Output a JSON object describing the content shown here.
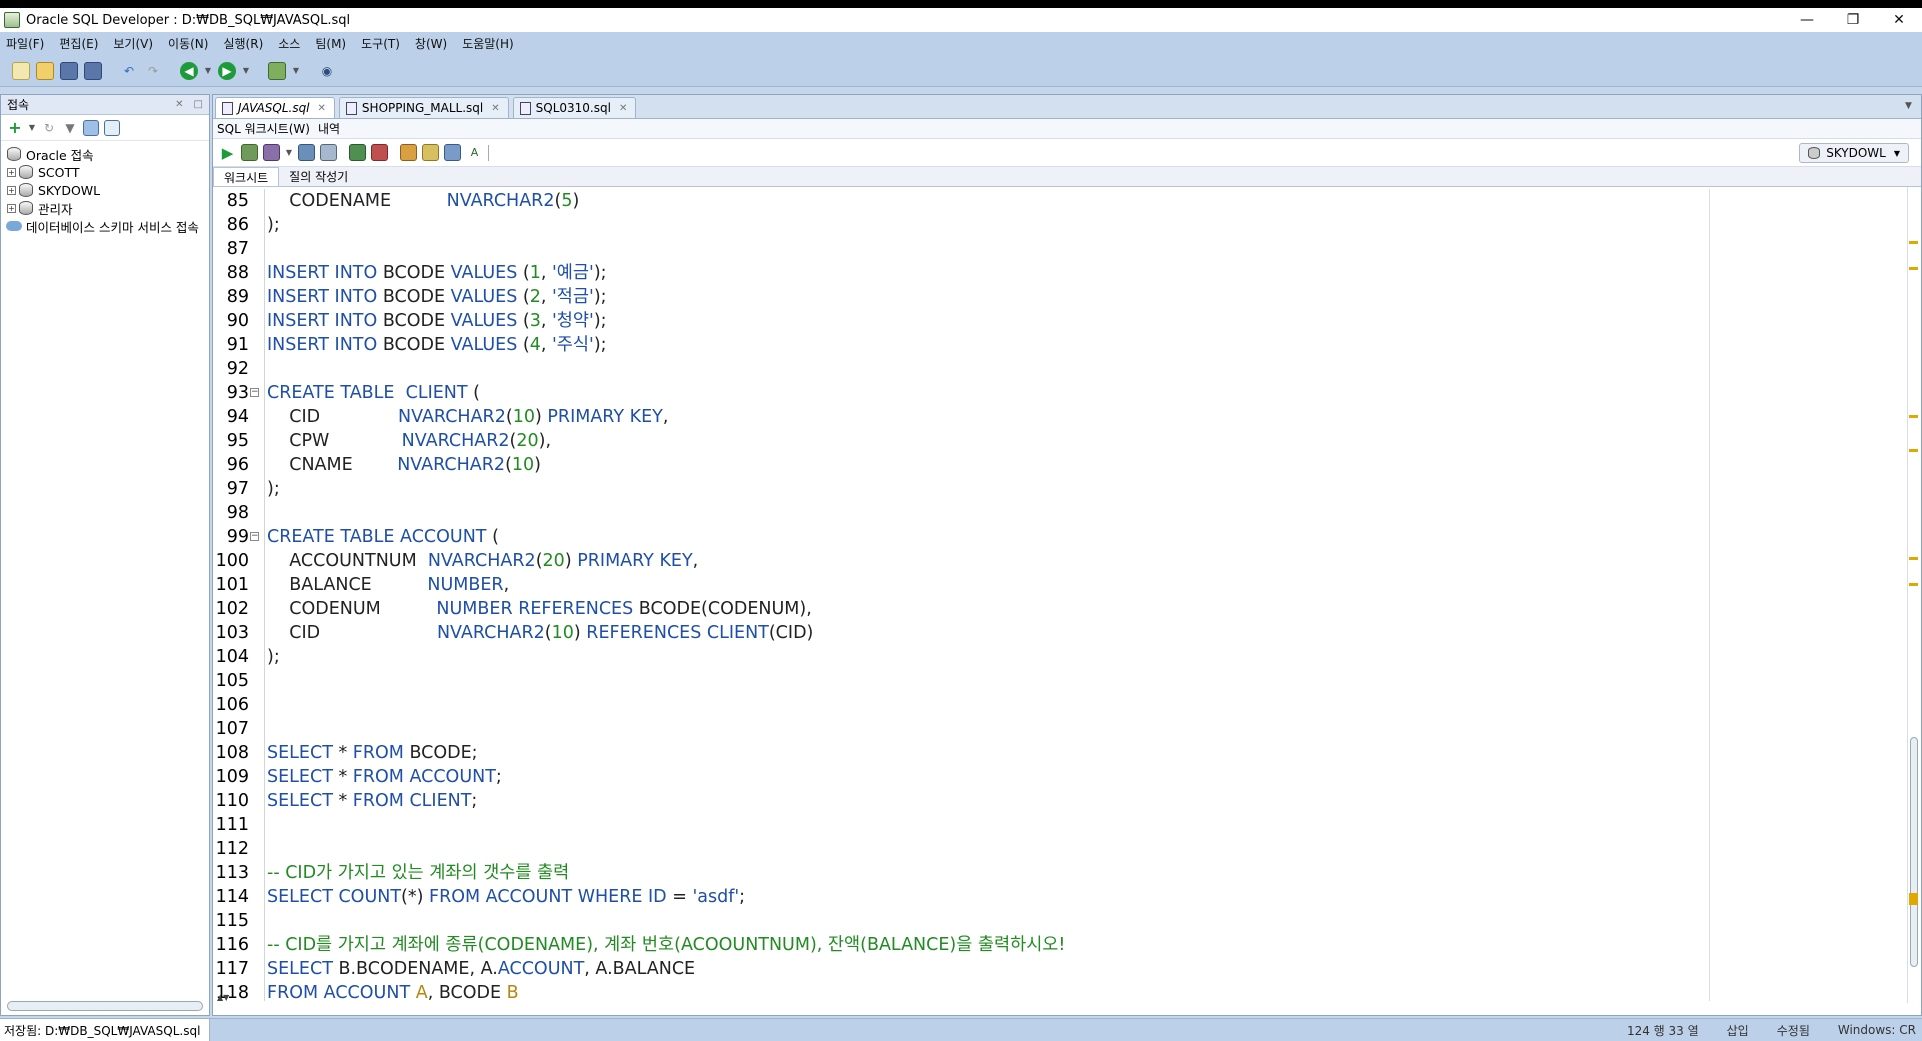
{
  "window": {
    "title": "Oracle SQL Developer : D:₩DB_SQL₩JAVASQL.sql"
  },
  "menu": [
    "파일(F)",
    "편집(E)",
    "보기(V)",
    "이동(N)",
    "실행(R)",
    "소스",
    "팀(M)",
    "도구(T)",
    "창(W)",
    "도움말(H)"
  ],
  "left_panel": {
    "title": "접속",
    "tree": [
      {
        "label": "Oracle 접속",
        "icon": "database-icon"
      },
      {
        "label": "SCOTT",
        "icon": "database-icon"
      },
      {
        "label": "SKYDOWL",
        "icon": "database-icon"
      },
      {
        "label": "관리자",
        "icon": "database-icon"
      },
      {
        "label": "데이터베이스 스키마 서비스 접속",
        "icon": "cloud-icon"
      }
    ]
  },
  "tabs": [
    "JAVASQL.sql",
    "SHOPPING_MALL.sql",
    "SQL0310.sql"
  ],
  "subtabs": {
    "worksheet": "SQL 워크시트(W)",
    "history": "내역"
  },
  "connection": "SKYDOWL",
  "ws_tabs": {
    "worksheet": "워크시트",
    "query_builder": "질의 작성기"
  },
  "code_lines": [
    {
      "n": "85",
      "t": [
        [
          "pl",
          "    CODENAME          "
        ],
        [
          "kw",
          "NVARCHAR2"
        ],
        [
          "pl",
          "("
        ],
        [
          "num",
          "5"
        ],
        [
          "pl",
          ")"
        ]
      ]
    },
    {
      "n": "86",
      "t": [
        [
          "pl",
          ");"
        ]
      ]
    },
    {
      "n": "87",
      "t": []
    },
    {
      "n": "88",
      "t": [
        [
          "kw",
          "INSERT INTO "
        ],
        [
          "pl",
          "BCODE "
        ],
        [
          "kw",
          "VALUES "
        ],
        [
          "pl",
          "("
        ],
        [
          "num",
          "1"
        ],
        [
          "pl",
          ", "
        ],
        [
          "str",
          "'예금'"
        ],
        [
          "pl",
          ");"
        ]
      ]
    },
    {
      "n": "89",
      "t": [
        [
          "kw",
          "INSERT INTO "
        ],
        [
          "pl",
          "BCODE "
        ],
        [
          "kw",
          "VALUES "
        ],
        [
          "pl",
          "("
        ],
        [
          "num",
          "2"
        ],
        [
          "pl",
          ", "
        ],
        [
          "str",
          "'적금'"
        ],
        [
          "pl",
          ");"
        ]
      ]
    },
    {
      "n": "90",
      "t": [
        [
          "kw",
          "INSERT INTO "
        ],
        [
          "pl",
          "BCODE "
        ],
        [
          "kw",
          "VALUES "
        ],
        [
          "pl",
          "("
        ],
        [
          "num",
          "3"
        ],
        [
          "pl",
          ", "
        ],
        [
          "str",
          "'청약'"
        ],
        [
          "pl",
          ");"
        ]
      ]
    },
    {
      "n": "91",
      "t": [
        [
          "kw",
          "INSERT INTO "
        ],
        [
          "pl",
          "BCODE "
        ],
        [
          "kw",
          "VALUES "
        ],
        [
          "pl",
          "("
        ],
        [
          "num",
          "4"
        ],
        [
          "pl",
          ", "
        ],
        [
          "str",
          "'주식'"
        ],
        [
          "pl",
          ");"
        ]
      ]
    },
    {
      "n": "92",
      "t": []
    },
    {
      "n": "93",
      "fold": true,
      "t": [
        [
          "kw",
          "CREATE TABLE  CLIENT "
        ],
        [
          "pl",
          "("
        ]
      ]
    },
    {
      "n": "94",
      "t": [
        [
          "pl",
          "    CID              "
        ],
        [
          "kw",
          "NVARCHAR2"
        ],
        [
          "pl",
          "("
        ],
        [
          "num",
          "10"
        ],
        [
          "pl",
          ") "
        ],
        [
          "kw",
          "PRIMARY KEY"
        ],
        [
          "pl",
          ","
        ]
      ]
    },
    {
      "n": "95",
      "t": [
        [
          "pl",
          "    CPW             "
        ],
        [
          "kw",
          "NVARCHAR2"
        ],
        [
          "pl",
          "("
        ],
        [
          "num",
          "20"
        ],
        [
          "pl",
          "),"
        ]
      ]
    },
    {
      "n": "96",
      "t": [
        [
          "pl",
          "    CNAME        "
        ],
        [
          "kw",
          "NVARCHAR2"
        ],
        [
          "pl",
          "("
        ],
        [
          "num",
          "10"
        ],
        [
          "pl",
          ")"
        ]
      ]
    },
    {
      "n": "97",
      "t": [
        [
          "pl",
          ");"
        ]
      ]
    },
    {
      "n": "98",
      "t": []
    },
    {
      "n": "99",
      "fold": true,
      "t": [
        [
          "kw",
          "CREATE TABLE ACCOUNT "
        ],
        [
          "pl",
          "("
        ]
      ]
    },
    {
      "n": "100",
      "t": [
        [
          "pl",
          "    ACCOUNTNUM  "
        ],
        [
          "kw",
          "NVARCHAR2"
        ],
        [
          "pl",
          "("
        ],
        [
          "num",
          "20"
        ],
        [
          "pl",
          ") "
        ],
        [
          "kw",
          "PRIMARY KEY"
        ],
        [
          "pl",
          ","
        ]
      ]
    },
    {
      "n": "101",
      "t": [
        [
          "pl",
          "    BALANCE          "
        ],
        [
          "kw",
          "NUMBER"
        ],
        [
          "pl",
          ","
        ]
      ]
    },
    {
      "n": "102",
      "t": [
        [
          "pl",
          "    CODENUM          "
        ],
        [
          "kw",
          "NUMBER REFERENCES "
        ],
        [
          "pl",
          "BCODE(CODENUM),"
        ]
      ]
    },
    {
      "n": "103",
      "t": [
        [
          "pl",
          "    CID                     "
        ],
        [
          "kw",
          "NVARCHAR2"
        ],
        [
          "pl",
          "("
        ],
        [
          "num",
          "10"
        ],
        [
          "pl",
          ") "
        ],
        [
          "kw",
          "REFERENCES CLIENT"
        ],
        [
          "pl",
          "(CID)"
        ]
      ]
    },
    {
      "n": "104",
      "t": [
        [
          "pl",
          ");"
        ]
      ]
    },
    {
      "n": "105",
      "t": []
    },
    {
      "n": "106",
      "t": []
    },
    {
      "n": "107",
      "t": []
    },
    {
      "n": "108",
      "t": [
        [
          "kw",
          "SELECT "
        ],
        [
          "pl",
          "* "
        ],
        [
          "kw",
          "FROM "
        ],
        [
          "pl",
          "BCODE;"
        ]
      ]
    },
    {
      "n": "109",
      "t": [
        [
          "kw",
          "SELECT "
        ],
        [
          "pl",
          "* "
        ],
        [
          "kw",
          "FROM ACCOUNT"
        ],
        [
          "pl",
          ";"
        ]
      ]
    },
    {
      "n": "110",
      "t": [
        [
          "kw",
          "SELECT "
        ],
        [
          "pl",
          "* "
        ],
        [
          "kw",
          "FROM CLIENT"
        ],
        [
          "pl",
          ";"
        ]
      ]
    },
    {
      "n": "111",
      "t": []
    },
    {
      "n": "112",
      "t": []
    },
    {
      "n": "113",
      "t": [
        [
          "cm",
          "-- CID가 가지고 있는 계좌의 갯수를 출력"
        ]
      ]
    },
    {
      "n": "114",
      "t": [
        [
          "kw",
          "SELECT COUNT"
        ],
        [
          "pl",
          "(*) "
        ],
        [
          "kw",
          "FROM ACCOUNT WHERE ID "
        ],
        [
          "pl",
          "= "
        ],
        [
          "str",
          "'asdf'"
        ],
        [
          "pl",
          ";"
        ]
      ]
    },
    {
      "n": "115",
      "t": []
    },
    {
      "n": "116",
      "t": [
        [
          "cm",
          "-- CID를 가지고 계좌에 종류(CODENAME), 계좌 번호(ACOOUNTNUM), 잔액(BALANCE)을 출력하시오!"
        ]
      ]
    },
    {
      "n": "117",
      "t": [
        [
          "kw",
          "SELECT "
        ],
        [
          "pl",
          "B.BCODENAME, A."
        ],
        [
          "kw",
          "ACCOUNT"
        ],
        [
          "pl",
          ", A.BALANCE"
        ]
      ]
    },
    {
      "n": "118",
      "t": [
        [
          "kw",
          "FROM ACCOUNT "
        ],
        [
          "alias",
          "A"
        ],
        [
          "pl",
          ", BCODE "
        ],
        [
          "alias",
          "B"
        ]
      ]
    }
  ],
  "status": {
    "saved": "저장됨: D:₩DB_SQL₩JAVASQL.sql",
    "position": "124 행 33 열",
    "mode": "삽입",
    "modified": "수정됨",
    "eol": "Windows: CR"
  }
}
